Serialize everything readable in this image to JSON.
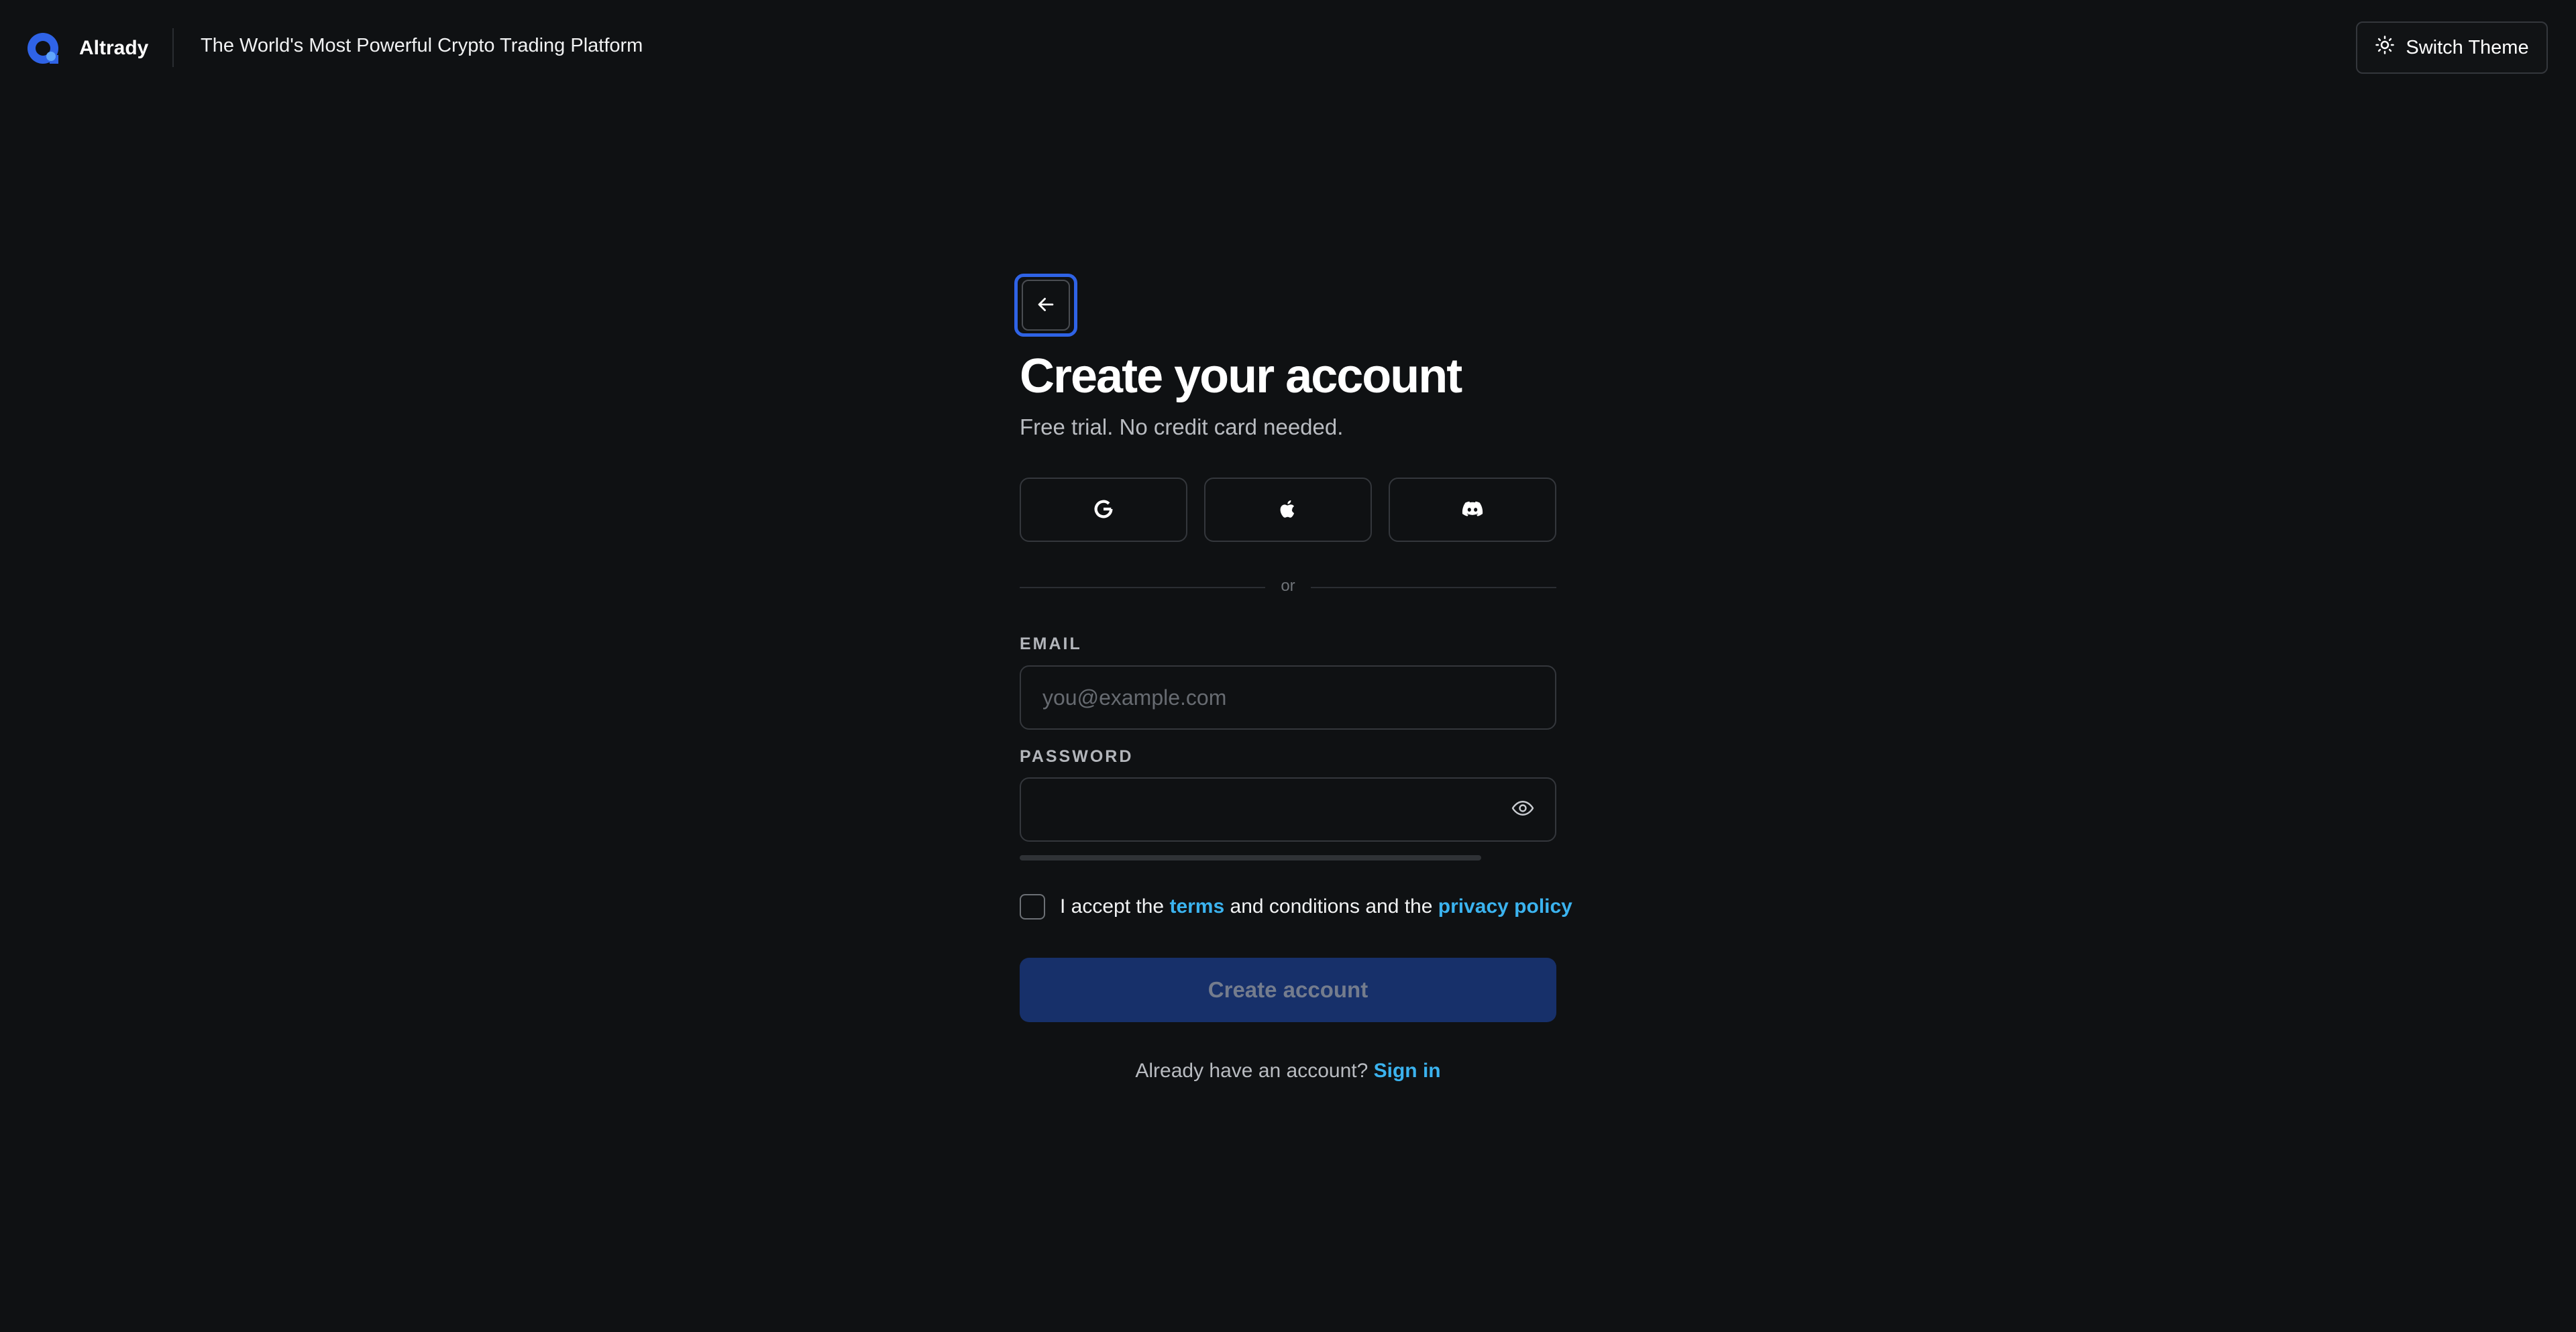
{
  "header": {
    "brand_name": "Altrady",
    "tagline": "The World's Most Powerful Crypto Trading Platform",
    "switch_theme_label": "Switch Theme"
  },
  "form": {
    "title": "Create your account",
    "subtitle": "Free trial. No credit card needed.",
    "social_providers": [
      "google-icon",
      "apple-icon",
      "discord-icon"
    ],
    "divider_text": "or",
    "email": {
      "label": "EMAIL",
      "value": "",
      "placeholder": "you@example.com"
    },
    "password": {
      "label": "PASSWORD",
      "value": "",
      "placeholder": ""
    },
    "terms": {
      "checked": false,
      "prefix": "I accept the",
      "terms_link": "terms",
      "middle": "and conditions and the",
      "privacy_link": "privacy policy"
    },
    "submit_label": "Create account",
    "signin_prompt": "Already have an account?",
    "signin_link": "Sign in"
  },
  "colors": {
    "background": "#0f1113",
    "accent_blue": "#2f63e6",
    "link_cyan": "#3bb3ef",
    "button_disabled": "#17306a"
  }
}
